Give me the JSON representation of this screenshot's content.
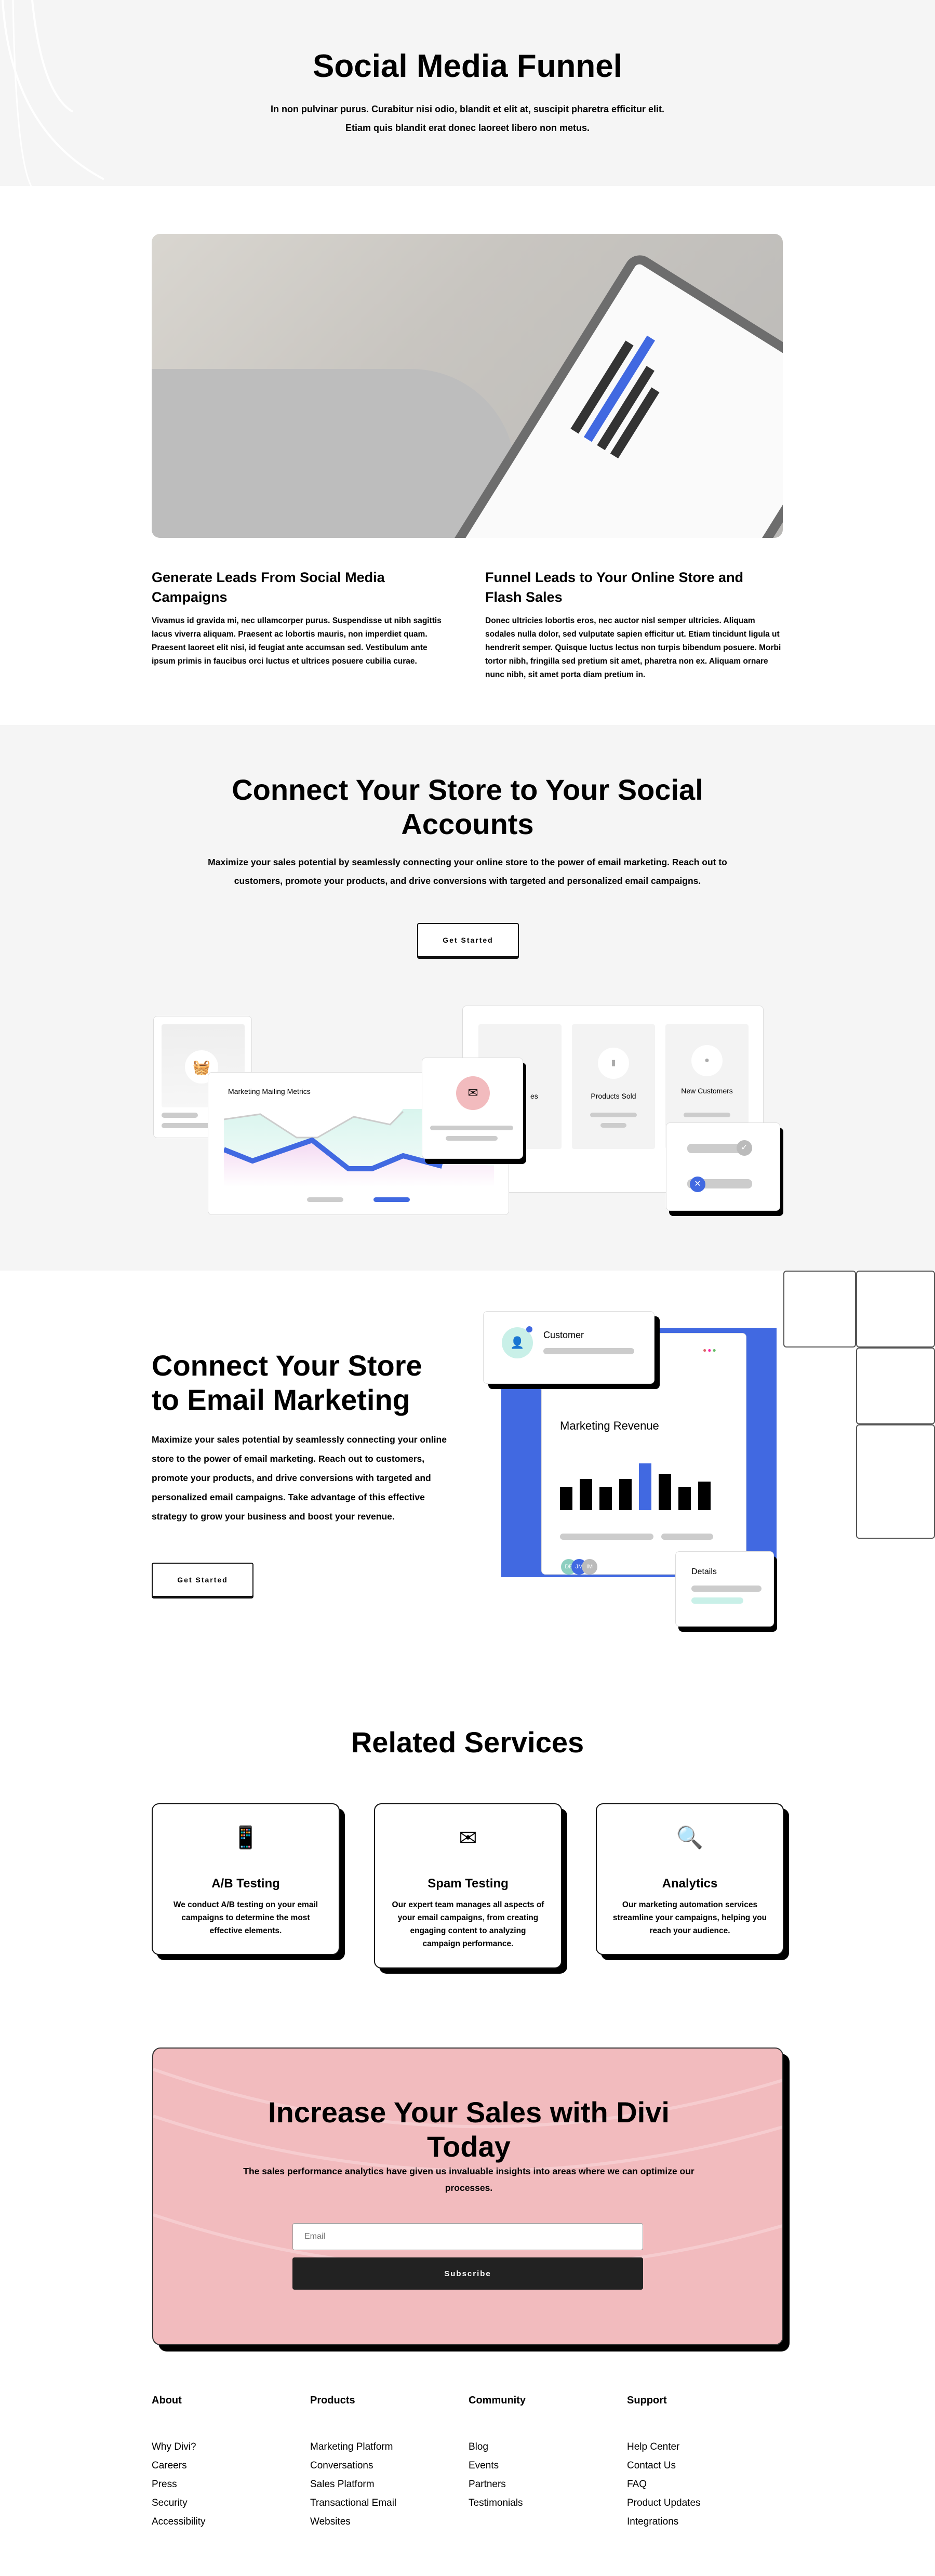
{
  "hero": {
    "title": "Social Media Funnel",
    "text": "In non pulvinar purus. Curabitur nisi odio, blandit et elit at, suscipit pharetra efficitur elit. Etiam quis blandit erat donec laoreet libero non metus."
  },
  "features": [
    {
      "title": "Generate Leads From Social Media Campaigns",
      "text": "Vivamus id gravida mi, nec ullamcorper purus. Suspendisse ut nibh sagittis lacus viverra aliquam. Praesent ac lobortis mauris, non imperdiet quam. Praesent laoreet elit nisi, id feugiat ante accumsan sed. Vestibulum ante ipsum primis in faucibus orci luctus et ultrices posuere cubilia curae."
    },
    {
      "title": "Funnel Leads to Your Online Store and Flash Sales",
      "text": "Donec ultricies lobortis eros, nec auctor nisl semper ultricies. Aliquam sodales nulla dolor, sed vulputate sapien efficitur ut. Etiam tincidunt ligula ut hendrerit semper. Quisque luctus lectus non turpis bibendum posuere. Morbi tortor nibh, fringilla sed pretium sit amet, pharetra non ex. Aliquam ornare nunc nibh, sit amet porta diam pretium in."
    }
  ],
  "social": {
    "title": "Connect Your Store to Your Social Accounts",
    "text": "Maximize your sales potential by seamlessly connecting your online store to the power of email marketing. Reach out to customers, promote your products, and drive conversions with targeted and personalized email campaigns.",
    "button": "Get Started",
    "illustration": {
      "chart_title": "Marketing Mailing Metrics",
      "stat_partial": "es",
      "stat_products": "Products Sold",
      "stat_customers": "New Customers"
    }
  },
  "email": {
    "title": "Connect Your Store to Email Marketing",
    "text": "Maximize your sales potential by seamlessly connecting your online store to the power of email marketing. Reach out to customers, promote your products, and drive conversions with targeted and personalized email campaigns. Take advantage of this effective strategy to grow your business and boost your revenue.",
    "button": "Get Started",
    "illustration": {
      "customer_label": "Customer",
      "revenue_title": "Marketing Revenue",
      "details_label": "Details",
      "avatars": [
        "DB",
        "JM",
        "IM"
      ]
    }
  },
  "services": {
    "title": "Related Services",
    "items": [
      {
        "icon": "phone-gear-icon",
        "title": "A/B Testing",
        "text": "We conduct A/B testing on your email campaigns to determine the most effective elements."
      },
      {
        "icon": "spam-mail-icon",
        "title": "Spam Testing",
        "text": "Our expert team manages all aspects of your email campaigns, from creating engaging content to analyzing campaign performance."
      },
      {
        "icon": "analytics-magnifier-icon",
        "title": "Analytics",
        "text": "Our marketing automation services streamline your campaigns, helping you reach your audience."
      }
    ]
  },
  "cta": {
    "title": "Increase Your Sales with Divi Today",
    "text": "The sales performance analytics have given us invaluable insights into areas where we can optimize our processes.",
    "email_placeholder": "Email",
    "button": "Subscribe",
    "color": "#f2bbbe"
  },
  "footer": {
    "columns": [
      {
        "title": "About",
        "links": [
          "Why Divi?",
          "Careers",
          "Press",
          "Security",
          "Accessibility"
        ]
      },
      {
        "title": "Products",
        "links": [
          "Marketing Platform",
          "Conversations",
          "Sales Platform",
          "Transactional Email",
          "Websites"
        ]
      },
      {
        "title": "Community",
        "links": [
          "Blog",
          "Events",
          "Partners",
          "Testimonials"
        ]
      },
      {
        "title": "Support",
        "links": [
          "Help Center",
          "Contact Us",
          "FAQ",
          "Product Updates",
          "Integrations"
        ]
      }
    ]
  },
  "colors": {
    "accent_blue": "#4169e1",
    "pink": "#f2bbbe",
    "mint": "#c9f0e8"
  }
}
